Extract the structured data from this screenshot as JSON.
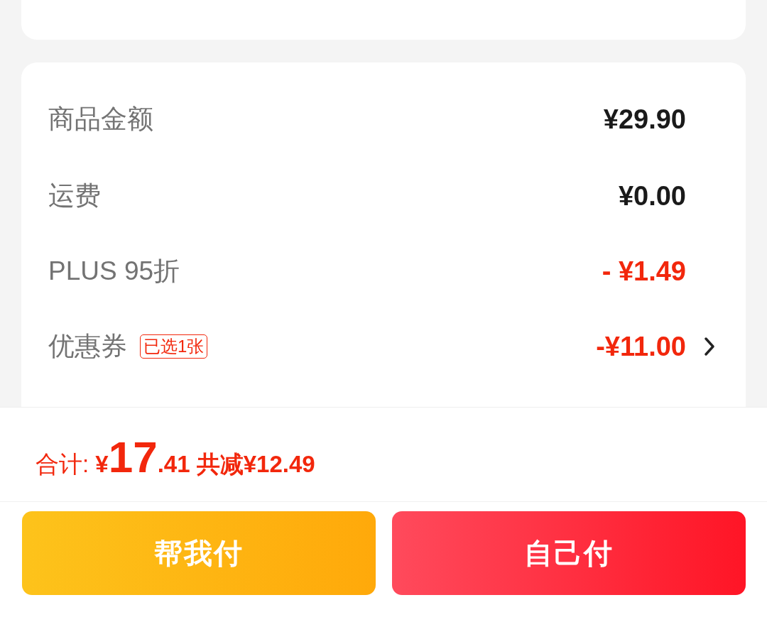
{
  "summary_rows": [
    {
      "label": "商品金额",
      "value": "¥29.90",
      "kind": "plain",
      "chevron": false
    },
    {
      "label": "运费",
      "value": "¥0.00",
      "kind": "plain",
      "chevron": false
    },
    {
      "label": "PLUS 95折",
      "value": "- ¥1.49",
      "kind": "discount",
      "chevron": false
    },
    {
      "label": "优惠券",
      "tag": "已选1张",
      "value": "-¥11.00",
      "kind": "discount",
      "chevron": true
    }
  ],
  "total": {
    "label": "合计:",
    "currency": "¥",
    "integer": "17",
    "decimal": ".41",
    "saving": "共减¥12.49"
  },
  "buttons": [
    {
      "label": "帮我付",
      "kind": "secondary"
    },
    {
      "label": "自己付",
      "kind": "primary"
    }
  ]
}
